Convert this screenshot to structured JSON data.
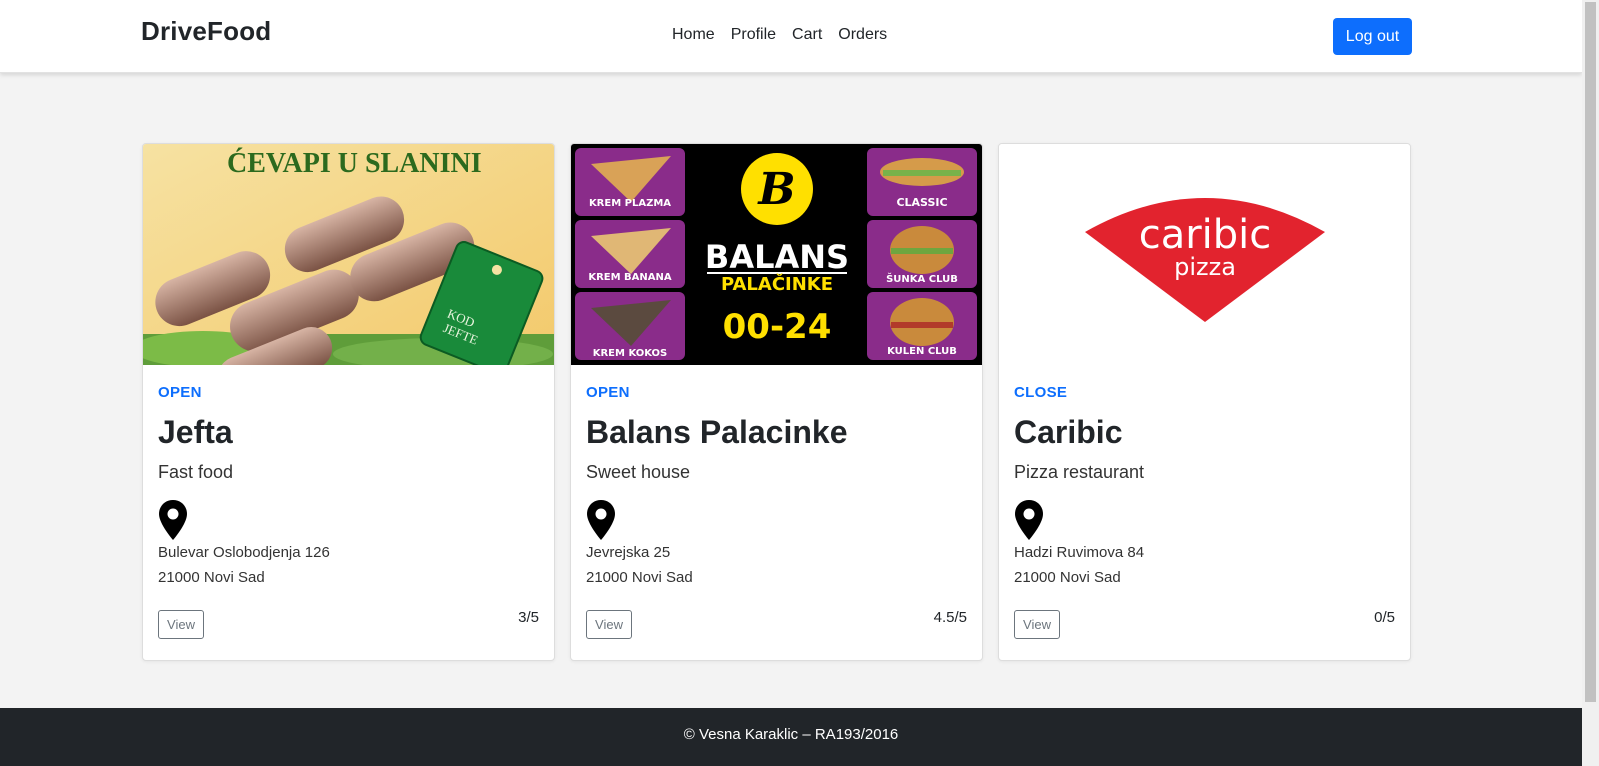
{
  "navbar": {
    "brand": "DriveFood",
    "links": [
      "Home",
      "Profile",
      "Cart",
      "Orders"
    ],
    "logout_label": "Log out",
    "accent_color": "#0d6efd"
  },
  "restaurants": [
    {
      "status": "OPEN",
      "name": "Jefta",
      "type": "Fast food",
      "address_line1": "Bulevar Oslobodjenja 126",
      "address_line2": "21000 Novi Sad",
      "view_label": "View",
      "rating": "3/5",
      "image": {
        "headline": "ĆEVAPI U SLANINI",
        "tag_text": "KOD JEFTE"
      }
    },
    {
      "status": "OPEN",
      "name": "Balans Palacinke",
      "type": "Sweet house",
      "address_line1": "Jevrejska 25",
      "address_line2": "21000 Novi Sad",
      "view_label": "View",
      "rating": "4.5/5",
      "image": {
        "logo_letter": "B",
        "title": "BALANS",
        "subtitle": "PALAČINKE",
        "hours": "00-24",
        "left_items": [
          "KREM PLAZMA",
          "KREM BANANA",
          "KREM KOKOS"
        ],
        "right_items": [
          "CLASSIC",
          "ŠUNKA CLUB",
          "KULEN CLUB"
        ]
      }
    },
    {
      "status": "CLOSE",
      "name": "Caribic",
      "type": "Pizza restaurant",
      "address_line1": "Hadzi Ruvimova 84",
      "address_line2": "21000 Novi Sad",
      "view_label": "View",
      "rating": "0/5",
      "image": {
        "logo_top": "caribic",
        "logo_bottom": "pizza"
      }
    }
  ],
  "footer": {
    "text": "© Vesna Karaklic – RA193/2016"
  },
  "icons": {
    "location": "location-pin-icon"
  }
}
